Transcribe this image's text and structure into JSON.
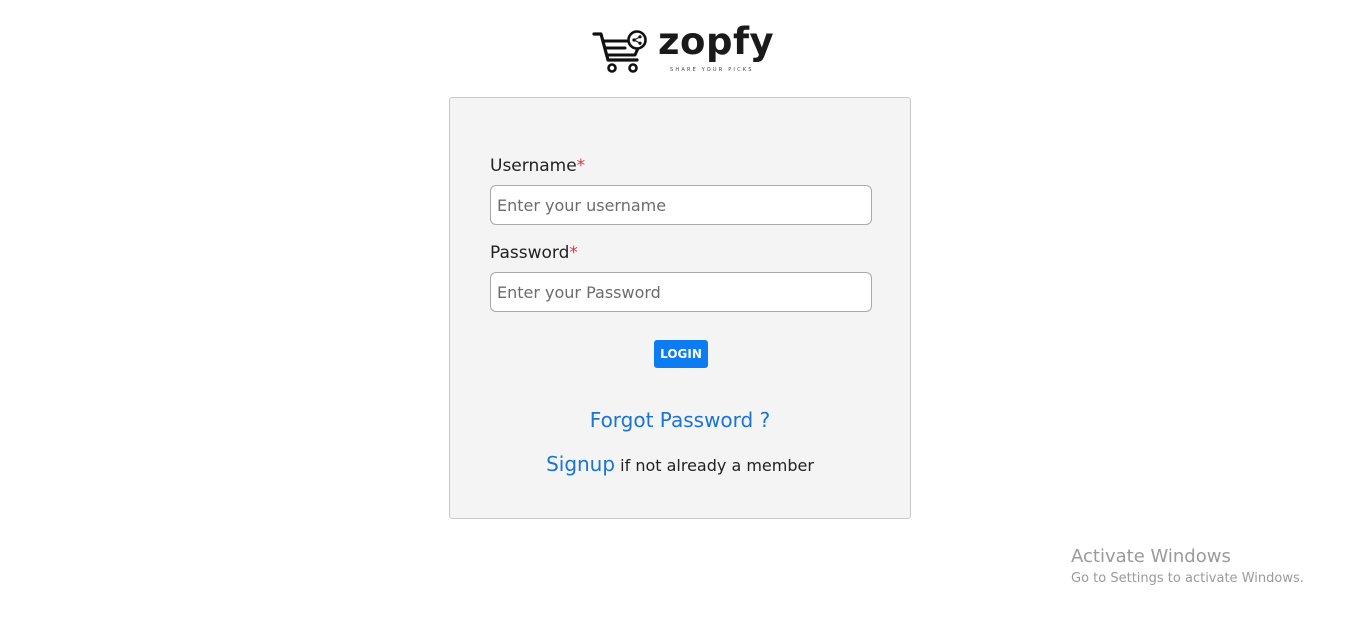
{
  "brand": {
    "name": "zopfy",
    "tagline": "SHARE YOUR PICKS",
    "logo_icon": "shopping-cart-share-icon"
  },
  "login_form": {
    "username": {
      "label": "Username",
      "required_marker": "*",
      "placeholder": "Enter your username",
      "value": ""
    },
    "password": {
      "label": "Password",
      "required_marker": "*",
      "placeholder": "Enter your Password",
      "value": ""
    },
    "submit_label": "LOGIN",
    "forgot_password_link": "Forgot Password ?",
    "signup_link": "Signup",
    "signup_suffix": "if not already a member"
  },
  "colors": {
    "primary_button": "#0d7cf2",
    "link": "#1a73d6",
    "required": "#dc3545",
    "card_background": "#f4f4f4"
  },
  "os_watermark": {
    "title": "Activate Windows",
    "subtitle": "Go to Settings to activate Windows."
  }
}
